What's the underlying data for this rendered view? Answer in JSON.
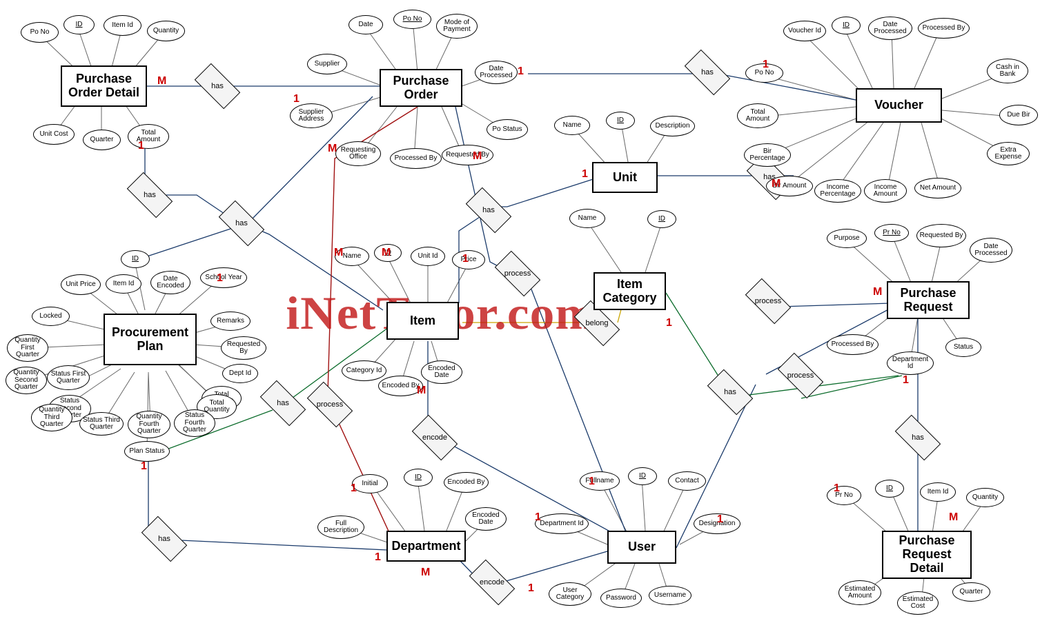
{
  "watermark": "iNetTutor.com",
  "entities": {
    "pod": "Purchase Order Detail",
    "po": "Purchase Order",
    "voucher": "Voucher",
    "unit": "Unit",
    "item": "Item",
    "itemcat": "Item Category",
    "pr": "Purchase Request",
    "pplan": "Procurement Plan",
    "dept": "Department",
    "user": "User",
    "prd": "Purchase Request Detail"
  },
  "relationships": {
    "has": "has",
    "process": "process",
    "encode": "encode",
    "belong": "belong"
  },
  "cardinality": {
    "one": "1",
    "many": "M"
  },
  "attrs": {
    "pod": {
      "po_no": "Po No",
      "id": "ID",
      "item_id": "Item Id",
      "qty": "Quantity",
      "unit_cost": "Unit Cost",
      "quarter": "Quarter",
      "total_amount": "Total Amount"
    },
    "po": {
      "date": "Date",
      "po_no": "Po No",
      "mode_payment": "Mode of Payment",
      "supplier": "Supplier",
      "date_processed": "Date Processed",
      "supplier_address": "Supplier Address",
      "po_status": "Po Status",
      "requesting_office": "Requesting Office",
      "processed_by": "Processed By",
      "requested_by": "Requested By"
    },
    "voucher": {
      "voucher_id": "Voucher Id",
      "id": "ID",
      "date_processed": "Date Processed",
      "processed_by": "Processed By",
      "po_no": "Po No",
      "cash_bank": "Cash in Bank",
      "total_amount": "Total Amount",
      "due_bir": "Due Bir",
      "bir_percentage": "Bir Percentage",
      "extra_expense": "Extra Expense",
      "bir_amount": "Bir Amount",
      "income_percentage": "Income Percentage",
      "income_amount": "Income Amount",
      "net_amount": "Net Amount"
    },
    "unit": {
      "name": "Name",
      "id": "ID",
      "description": "Description"
    },
    "itemcat": {
      "name": "Name",
      "id": "ID"
    },
    "item": {
      "name": "Name",
      "id": "ID",
      "unit_id": "Unit Id",
      "price": "Price",
      "category_id": "Category Id",
      "encoded_date": "Encoded Date",
      "encoded_by": "Encoded By"
    },
    "pr": {
      "purpose": "Purpose",
      "pr_no": "Pr No",
      "requested_by": "Requested By",
      "date_processed": "Date Processed",
      "processed_by": "Processed By",
      "status": "Status",
      "department_id": "Department Id"
    },
    "pplan": {
      "id": "ID",
      "unit_price": "Unit Price",
      "item_id": "Item Id",
      "date_encoded": "Date Encoded",
      "school_year": "School Year",
      "locked": "Locked",
      "remarks": "Remarks",
      "requested_by": "Requested By",
      "dept_id": "Dept Id",
      "q1": "Quantity First Quarter",
      "s1": "Status First Quarter",
      "q2": "Quantity Second Quarter",
      "s2": "Status Second Quarter",
      "q3": "Quantity Third Quarter",
      "s3": "Status Third Quarter",
      "q4": "Quantity Fourth Quarter",
      "s4": "Status Fourth Quarter",
      "total_amount": "Total Amount",
      "total_qty": "Total Quantity",
      "plan_status": "Plan Status"
    },
    "dept": {
      "initial": "Initial",
      "id": "ID",
      "encoded_by": "Encoded By",
      "full_desc": "Full Description",
      "encoded_date": "Encoded Date"
    },
    "user": {
      "fullname": "Fullname",
      "id": "ID",
      "contact": "Contact",
      "department_id": "Department Id",
      "designation": "Designation",
      "user_category": "User Category",
      "password": "Password",
      "username": "Username"
    },
    "prd": {
      "pr_no": "Pr No",
      "id": "ID",
      "item_id": "Item Id",
      "quantity": "Quantity",
      "est_amount": "Estimated Amount",
      "est_cost": "Estimated Cost",
      "quarter": "Quarter"
    }
  }
}
